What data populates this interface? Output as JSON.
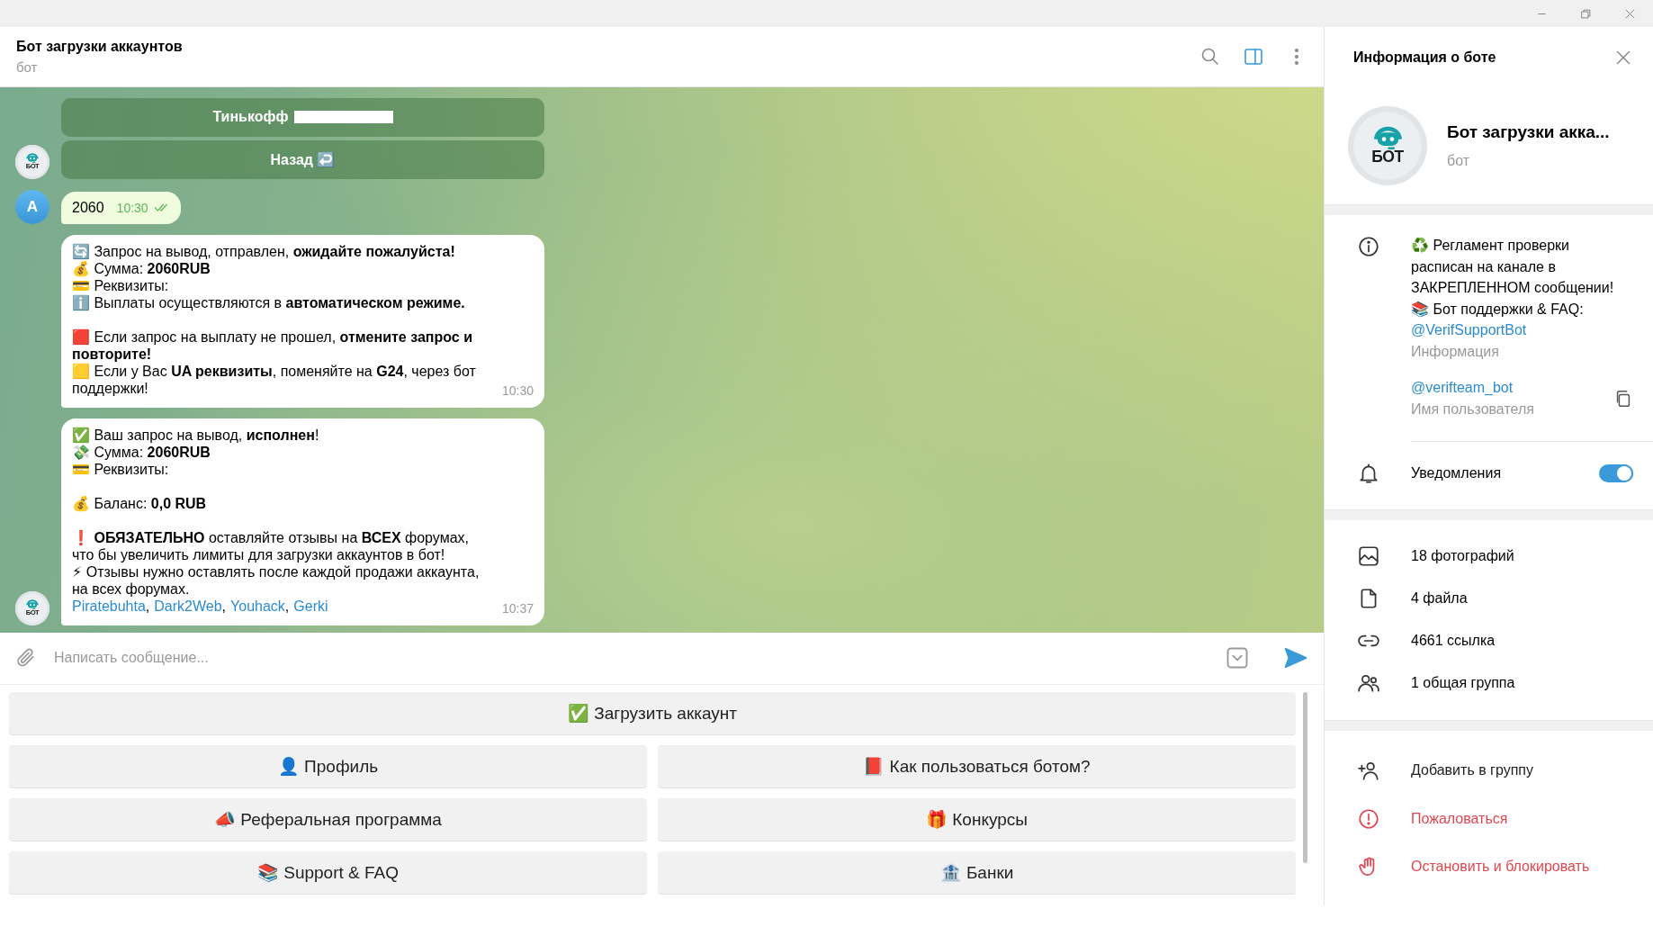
{
  "chat_header": {
    "title": "Бот загрузки аккаунтов",
    "subtitle": "бот"
  },
  "messages": [
    {
      "kind": "inline_keyboard",
      "avatar": "БОТ",
      "buttons": [
        {
          "label": "Тинькофф",
          "redacted": true
        },
        {
          "label": "Назад ↩️",
          "redacted": false
        }
      ]
    },
    {
      "kind": "outgoing",
      "avatar": "A",
      "text": "2060",
      "time": "10:30",
      "read": true
    },
    {
      "kind": "incoming",
      "time": "10:30",
      "paragraphs": [
        [
          "🔄 Запрос на вывод,  отправлен, **ожидайте пожалуйста!**",
          "💰 Сумма: **2060RUB**",
          "💳 Реквизиты:",
          "ℹ️ Выплаты осуществляются в **автоматическом режиме.**"
        ],
        [
          "🟥 Если запрос на выплату не прошел, **отмените запрос и повторите!**",
          "🟨 Если у Вас **UA реквизиты**, поменяйте на **G24**, через бот поддержки!"
        ]
      ]
    },
    {
      "kind": "incoming",
      "avatar": "БОТ",
      "time": "10:37",
      "paragraphs": [
        [
          "✅ Ваш запрос на вывод, **исполнен**!",
          "💸 Сумма: **2060RUB**",
          "💳 Реквизиты:"
        ],
        [
          "💰 Баланс: **0,0 RUB**"
        ],
        [
          "❗ **ОБЯЗАТЕЛЬНО** оставляйте отзывы на **ВСЕХ** форумах, что бы увеличить лимиты для загрузки аккаунтов в бот!",
          "⚡ Отзывы нужно оставлять после каждой продажи аккаунта, на всех форумах."
        ]
      ],
      "links": [
        "Piratebuhta",
        "Dark2Web",
        "Youhack",
        "Gerki"
      ],
      "link_separator": ","
    }
  ],
  "composer": {
    "placeholder": "Написать сообщение..."
  },
  "keyboard": [
    [
      "✅ Загрузить аккаунт"
    ],
    [
      "👤 Профиль",
      "📕 Как пользоваться ботом?"
    ],
    [
      "📣 Реферальная программа",
      "🎁 Конкурсы"
    ],
    [
      "📚 Support & FAQ",
      "🏦 Банки"
    ]
  ],
  "info_panel": {
    "title": "Информация о боте",
    "avatar": "БОТ",
    "name": "Бот загрузки акка...",
    "subtitle": "бот",
    "bio": "♻️ Регламент проверки расписан на канале в ЗАКРЕПЛЕННОМ сообщении!\n📚 Бот поддержки & FAQ:",
    "bio_link": "@VerifSupportBot",
    "bio_label": "Информация",
    "username": "@verifteam_bot",
    "username_label": "Имя пользователя",
    "notifications": {
      "label": "Уведомления",
      "on": true
    },
    "media": [
      {
        "kind": "photos",
        "label": "18 фотографий"
      },
      {
        "kind": "files",
        "label": "4 файла"
      },
      {
        "kind": "links",
        "label": "4661 ссылка"
      },
      {
        "kind": "groups",
        "label": "1 общая группа"
      }
    ],
    "actions": [
      {
        "kind": "add",
        "label": "Добавить в группу",
        "danger": false
      },
      {
        "kind": "report",
        "label": "Пожаловаться",
        "danger": true
      },
      {
        "kind": "block",
        "label": "Остановить и блокировать",
        "danger": true
      }
    ]
  }
}
